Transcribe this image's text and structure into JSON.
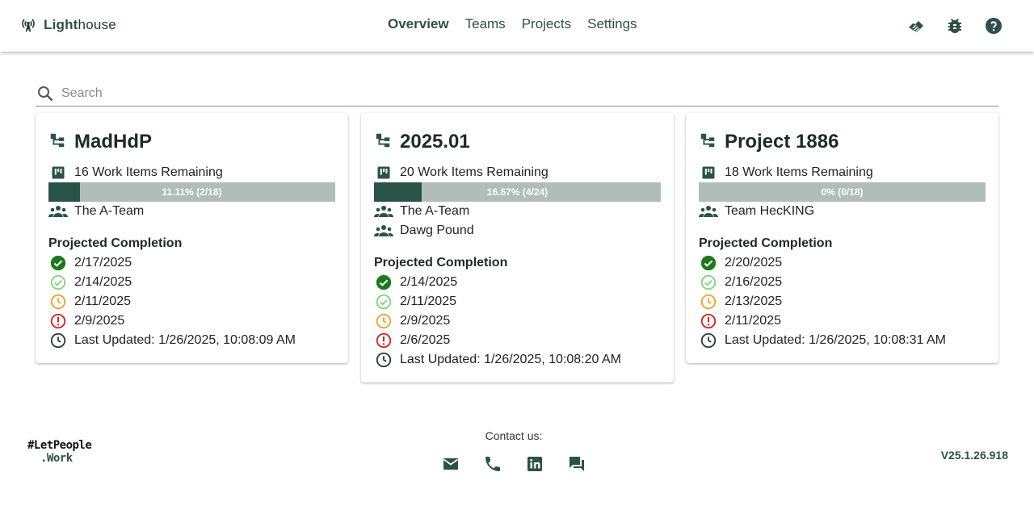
{
  "app": {
    "brand_prefix": "Light",
    "brand_suffix": "house",
    "colors": {
      "primary": "#2f4f48",
      "progress_fill": "#2a5347",
      "progress_track": "#b0bdb8",
      "status_done": "#1b7a1b",
      "status_likely": "#7fd67f",
      "status_warning": "#f2a12c",
      "status_danger": "#d62020"
    }
  },
  "nav": {
    "items": [
      {
        "label": "Overview",
        "active": true
      },
      {
        "label": "Teams",
        "active": false
      },
      {
        "label": "Projects",
        "active": false
      },
      {
        "label": "Settings",
        "active": false
      }
    ],
    "icons": [
      "handshake-icon",
      "bug-icon",
      "help-icon"
    ]
  },
  "search": {
    "placeholder": "Search",
    "value": ""
  },
  "cards": [
    {
      "title": "MadHdP",
      "remaining": "16 Work Items Remaining",
      "progress_text": "11.11% (2/18)",
      "progress_fraction": 0.1111,
      "teams": [
        "The A-Team"
      ],
      "projected_heading": "Projected Completion",
      "dates": [
        "2/17/2025",
        "2/14/2025",
        "2/11/2025",
        "2/9/2025"
      ],
      "last_updated": "Last Updated: 1/26/2025, 10:08:09 AM"
    },
    {
      "title": "2025.01",
      "remaining": "20 Work Items Remaining",
      "progress_text": "16.67% (4/24)",
      "progress_fraction": 0.1667,
      "teams": [
        "The A-Team",
        "Dawg Pound"
      ],
      "projected_heading": "Projected Completion",
      "dates": [
        "2/14/2025",
        "2/11/2025",
        "2/9/2025",
        "2/6/2025"
      ],
      "last_updated": "Last Updated: 1/26/2025, 10:08:20 AM"
    },
    {
      "title": "Project 1886",
      "remaining": "18 Work Items Remaining",
      "progress_text": "0% (0/18)",
      "progress_fraction": 0,
      "teams": [
        "Team HecKING"
      ],
      "projected_heading": "Projected Completion",
      "dates": [
        "2/20/2025",
        "2/16/2025",
        "2/13/2025",
        "2/11/2025"
      ],
      "last_updated": "Last Updated: 1/26/2025, 10:08:31 AM"
    }
  ],
  "footer": {
    "brand_line1": "#LetPeople",
    "brand_line2": ".Work",
    "contact_label": "Contact us:",
    "contact_icons": [
      "email-icon",
      "phone-icon",
      "linkedin-icon",
      "chat-icon"
    ],
    "version": "V25.1.26.918"
  }
}
